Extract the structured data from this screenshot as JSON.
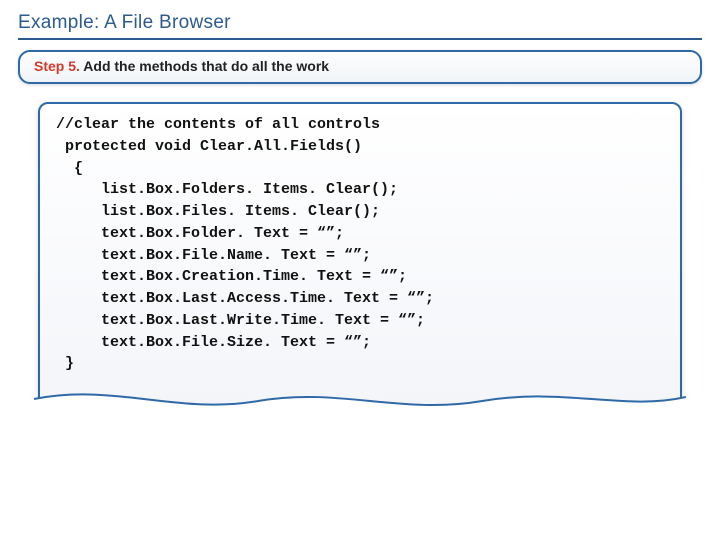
{
  "title": "Example: A File Browser",
  "step": {
    "label": "Step 5.",
    "text": " Add the methods that do all the work"
  },
  "code": {
    "lines": [
      "//clear the contents of all controls",
      " protected void Clear.All.Fields()",
      "  {",
      "     list.Box.Folders. Items. Clear();",
      "     list.Box.Files. Items. Clear();",
      "     text.Box.Folder. Text = “”;",
      "     text.Box.File.Name. Text = “”;",
      "     text.Box.Creation.Time. Text = “”;",
      "     text.Box.Last.Access.Time. Text = “”;",
      "     text.Box.Last.Write.Time. Text = “”;",
      "     text.Box.File.Size. Text = “”;",
      " }"
    ]
  }
}
